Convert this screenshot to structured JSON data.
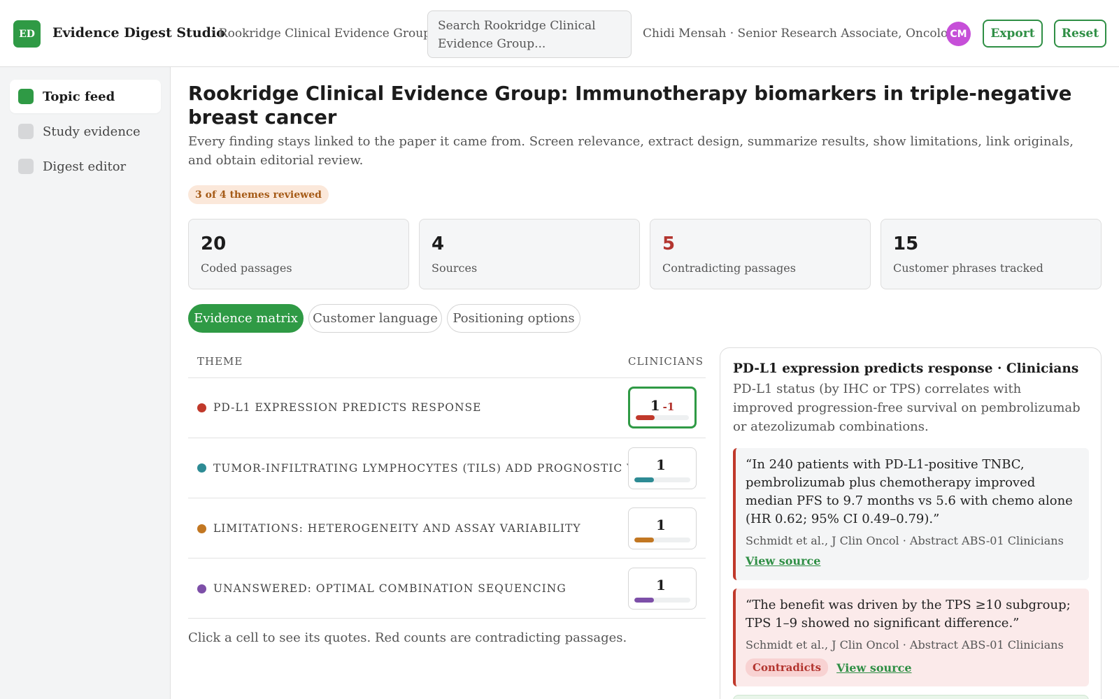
{
  "app": {
    "logo_initials": "ED",
    "title": "Evidence Digest Studio",
    "org": "· Rookridge Clinical Evidence Group",
    "search_placeholder": "Search Rookridge Clinical Evidence Group...",
    "user": "Chidi Mensah · Senior Research Associate, Oncology",
    "avatar_initials": "CM",
    "export_label": "Export",
    "reset_label": "Reset"
  },
  "sidebar": {
    "items": [
      {
        "label": "Topic feed",
        "active": true
      },
      {
        "label": "Study evidence",
        "active": false
      },
      {
        "label": "Digest editor",
        "active": false
      }
    ]
  },
  "main": {
    "title": "Rookridge Clinical Evidence Group: Immunotherapy biomarkers in triple-negative breast cancer",
    "subtitle": "Every finding stays linked to the paper it came from. Screen relevance, extract design, summarize results, show limitations, link originals, and obtain editorial review.",
    "badge": "3 of 4 themes reviewed",
    "stats": [
      {
        "value": "20",
        "label": "Coded passages"
      },
      {
        "value": "4",
        "label": "Sources"
      },
      {
        "value": "5",
        "label": "Contradicting passages",
        "highlight": "#b3352f"
      },
      {
        "value": "15",
        "label": "Customer phrases tracked"
      }
    ],
    "tabs": [
      {
        "label": "Evidence matrix",
        "active": true
      },
      {
        "label": "Customer language",
        "active": false
      },
      {
        "label": "Positioning options",
        "active": false
      }
    ]
  },
  "matrix": {
    "col_theme": "THEME",
    "col_segment": "CLINICIANS",
    "rows": [
      {
        "theme": "PD-L1 EXPRESSION PREDICTS RESPONSE",
        "color": "#c0392b",
        "count": "1",
        "contradicting": "-1",
        "fill": 0.35,
        "selected": true
      },
      {
        "theme": "TUMOR-INFILTRATING LYMPHOCYTES (TILS) ADD PROGNOSTIC VALUE",
        "color": "#2e8b94",
        "count": "1",
        "contradicting": "",
        "fill": 0.35,
        "selected": false
      },
      {
        "theme": "LIMITATIONS: HETEROGENEITY AND ASSAY VARIABILITY",
        "color": "#c27722",
        "count": "1",
        "contradicting": "",
        "fill": 0.35,
        "selected": false
      },
      {
        "theme": "UNANSWERED: OPTIMAL COMBINATION SEQUENCING",
        "color": "#7d4fa8",
        "count": "1",
        "contradicting": "",
        "fill": 0.35,
        "selected": false
      }
    ],
    "note": "Click a cell to see its quotes. Red counts are contradicting passages."
  },
  "detail": {
    "title": "PD-L1 expression predicts response · Clinicians",
    "subtitle": "PD-L1 status (by IHC or TPS) correlates with improved progression-free survival on pembrolizumab or atezolizumab combinations.",
    "quotes": [
      {
        "text": "“In 240 patients with PD-L1-positive TNBC, pembrolizumab plus chemotherapy improved median PFS to 9.7 months vs 5.6 with chemo alone (HR 0.62; 95% CI 0.49–0.79).”",
        "meta": "Schmidt et al., J Clin Oncol · Abstract ABS-01  Clinicians",
        "tag": "",
        "link": "View source"
      },
      {
        "text": "“The benefit was driven by the TPS ≥10 subgroup; TPS 1–9 showed no significant difference.”",
        "meta": "Schmidt et al., J Clin Oncol · Abstract ABS-01  Clinicians",
        "tag": "Contradicts",
        "link": "View source"
      }
    ]
  }
}
